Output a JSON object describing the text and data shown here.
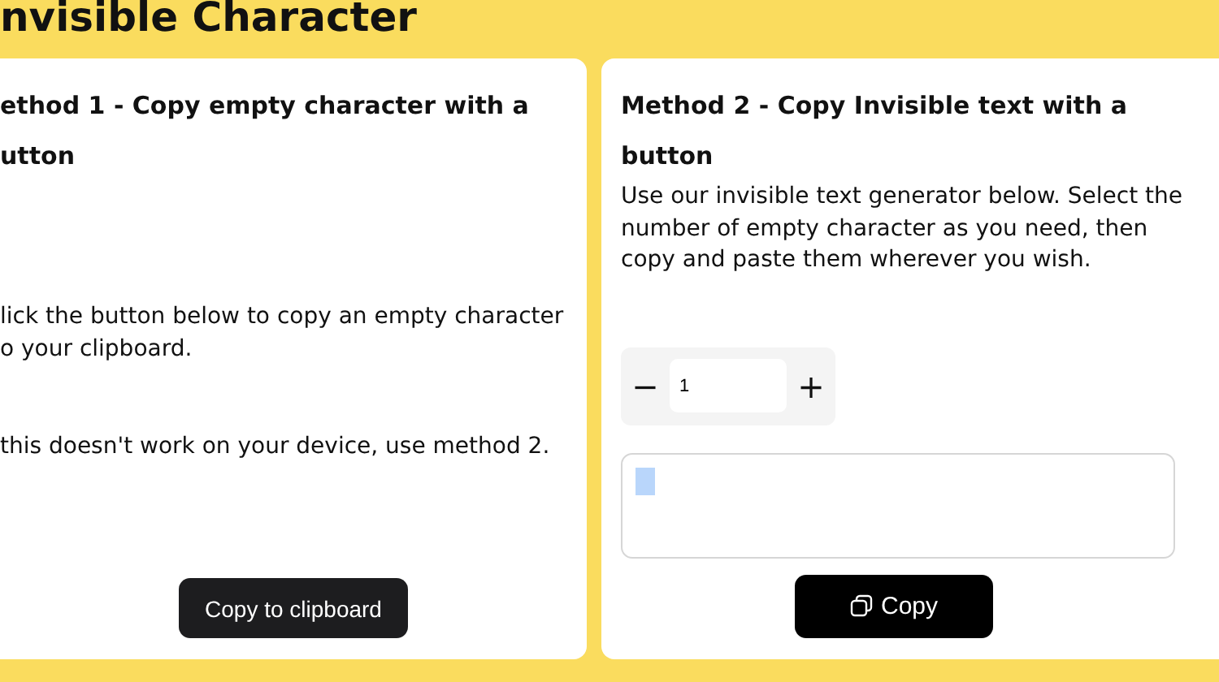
{
  "page_title": "nvisible Character",
  "method_1": {
    "heading": "ethod 1 - Copy empty character with a utton",
    "instruction": "lick the button below to copy an empty character o your clipboard.",
    "fallback_note": "this doesn't work on your device, use method 2.",
    "button": "Copy to clipboard"
  },
  "method_2": {
    "heading": "Method 2 - Copy Invisible text with a button",
    "description": "Use our invisible text generator below. Select the number of empty character as you need, then copy and paste them wherever you wish.",
    "decrement": "−",
    "count": "1",
    "increment": "+",
    "output_selected": true,
    "button": "Copy"
  }
}
